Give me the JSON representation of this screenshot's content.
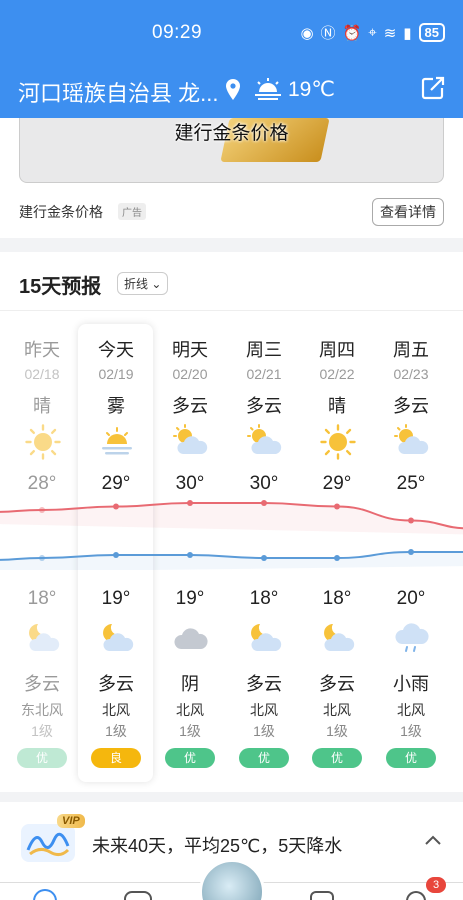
{
  "status_bar": {
    "time": "09:29",
    "battery": "85"
  },
  "header": {
    "location": "河口瑶族自治县 龙...",
    "temperature": "19℃"
  },
  "ad": {
    "banner_text": "建行金条价格",
    "title": "建行金条价格",
    "ad_tag": "广告",
    "detail_button": "查看详情"
  },
  "forecast": {
    "heading": "15天预报",
    "mode_selector": "折线",
    "days": [
      {
        "day": "昨天",
        "date": "02/18",
        "weather": "晴",
        "day_icon": "sun-icon",
        "high": "28°",
        "low": "18°",
        "night_icon": "partly-cloudy-night-icon",
        "night_weather": "多云",
        "wind": "东北风",
        "level": "1级",
        "aqi": "优"
      },
      {
        "day": "今天",
        "date": "02/19",
        "weather": "雾",
        "day_icon": "fog-icon",
        "high": "29°",
        "low": "19°",
        "night_icon": "partly-cloudy-night-icon",
        "night_weather": "多云",
        "wind": "北风",
        "level": "1级",
        "aqi": "良"
      },
      {
        "day": "明天",
        "date": "02/20",
        "weather": "多云",
        "day_icon": "partly-cloudy-day-icon",
        "high": "30°",
        "low": "19°",
        "night_icon": "overcast-icon",
        "night_weather": "阴",
        "wind": "北风",
        "level": "1级",
        "aqi": "优"
      },
      {
        "day": "周三",
        "date": "02/21",
        "weather": "多云",
        "day_icon": "partly-cloudy-day-icon",
        "high": "30°",
        "low": "18°",
        "night_icon": "partly-cloudy-night-icon",
        "night_weather": "多云",
        "wind": "北风",
        "level": "1级",
        "aqi": "优"
      },
      {
        "day": "周四",
        "date": "02/22",
        "weather": "晴",
        "day_icon": "sun-icon",
        "high": "29°",
        "low": "18°",
        "night_icon": "partly-cloudy-night-icon",
        "night_weather": "多云",
        "wind": "北风",
        "level": "1级",
        "aqi": "优"
      },
      {
        "day": "周五",
        "date": "02/23",
        "weather": "多云",
        "day_icon": "partly-cloudy-day-icon",
        "high": "25°",
        "low": "20°",
        "night_icon": "light-rain-icon",
        "night_weather": "小雨",
        "wind": "北风",
        "level": "1级",
        "aqi": "优"
      }
    ]
  },
  "summary": {
    "vip_label": "VIP",
    "message": "未来40天，平均25℃，5天降水"
  },
  "tabbar": {
    "notification_count": "3"
  },
  "chart_data": {
    "type": "line",
    "categories": [
      "昨天",
      "今天",
      "明天",
      "周三",
      "周四",
      "周五"
    ],
    "series": [
      {
        "values": [
          28,
          29,
          30,
          30,
          29,
          25
        ],
        "color": "#e86a72"
      },
      {
        "values": [
          18,
          19,
          19,
          18,
          18,
          20
        ],
        "color": "#5b9bd8"
      }
    ]
  }
}
